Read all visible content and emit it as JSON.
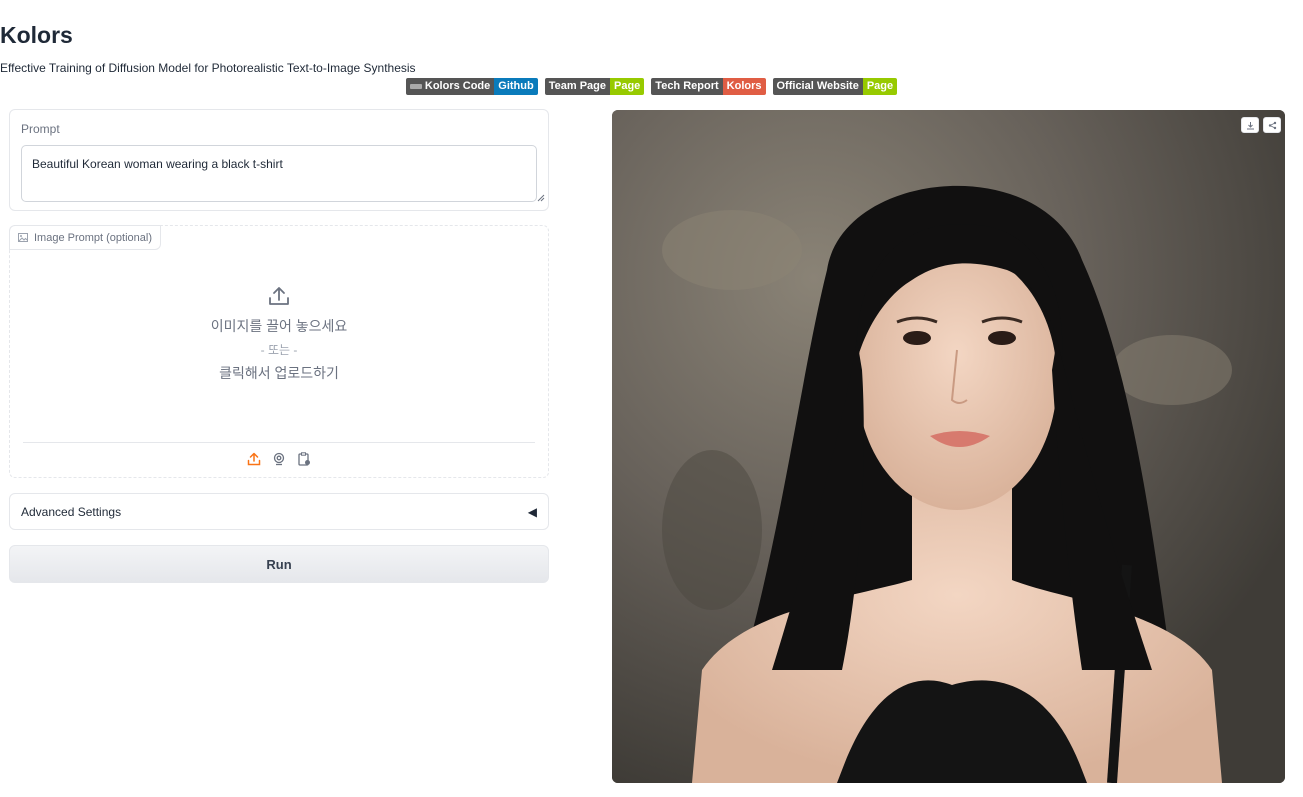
{
  "header": {
    "title": "Kolors",
    "subtitle": "Effective Training of Diffusion Model for Photorealistic Text-to-Image Synthesis",
    "badges": [
      {
        "label": "Kolors Code",
        "value": "Github",
        "color": "#0a7bbb"
      },
      {
        "label": "Team Page",
        "value": "Page",
        "color": "#97ca00"
      },
      {
        "label": "Tech Report",
        "value": "Kolors",
        "color": "#e05d44"
      },
      {
        "label": "Official Website",
        "value": "Page",
        "color": "#97ca00"
      }
    ]
  },
  "prompt": {
    "label": "Prompt",
    "value": "Beautiful Korean woman wearing a black t-shirt"
  },
  "image_prompt": {
    "label": "Image Prompt (optional)",
    "drop_text": "이미지를 끌어 놓으세요",
    "or_text": "- 또는 -",
    "click_text": "클릭해서 업로드하기",
    "sources": [
      "upload-icon",
      "webcam-icon",
      "clipboard-icon"
    ],
    "active_color": "#f97316"
  },
  "advanced": {
    "label": "Advanced Settings",
    "arrow": "◀"
  },
  "run": {
    "label": "Run"
  },
  "output": {
    "image_desc": "generated portrait",
    "actions": [
      "download-icon",
      "share-icon"
    ]
  }
}
